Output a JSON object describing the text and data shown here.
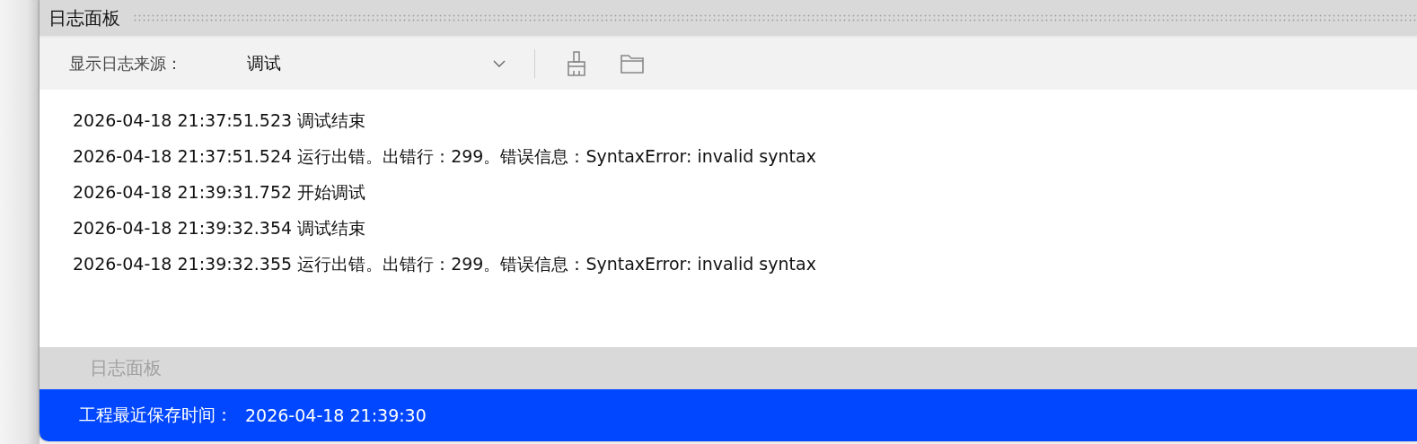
{
  "panel": {
    "title": "日志面板"
  },
  "toolbar": {
    "source_label": "显示日志来源：",
    "source_value": "调试"
  },
  "log_lines": [
    "2026-04-18 21:37:51.523 调试结束",
    "2026-04-18 21:37:51.524 运行出错。出错行：299。错误信息：SyntaxError: invalid syntax",
    "2026-04-18 21:39:31.752 开始调试",
    "2026-04-18 21:39:32.354 调试结束",
    "2026-04-18 21:39:32.355 运行出错。出错行：299。错误信息：SyntaxError: invalid syntax"
  ],
  "bottom_tabs": [
    {
      "label": "日志面板",
      "selected": false
    }
  ],
  "status_bar": {
    "label": "工程最近保存时间：",
    "value": "2026-04-18 21:39:30"
  }
}
